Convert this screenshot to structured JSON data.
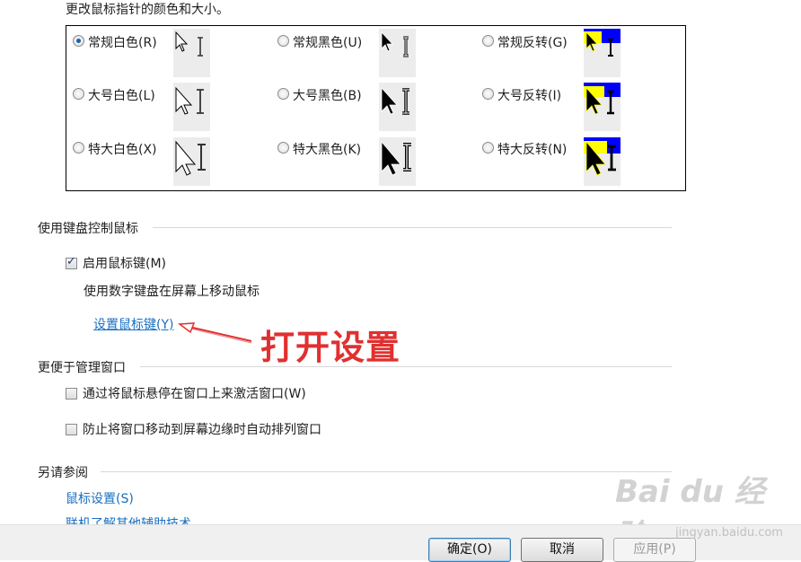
{
  "title": "更改鼠标指针的颜色和大小。",
  "schemes": [
    {
      "label": "常规白色(R)",
      "checked": true,
      "style": "white",
      "size": "normal"
    },
    {
      "label": "常规黑色(U)",
      "checked": false,
      "style": "black",
      "size": "normal"
    },
    {
      "label": "常规反转(G)",
      "checked": false,
      "style": "invert",
      "size": "normal"
    },
    {
      "label": "大号白色(L)",
      "checked": false,
      "style": "white",
      "size": "large"
    },
    {
      "label": "大号黑色(B)",
      "checked": false,
      "style": "black",
      "size": "large"
    },
    {
      "label": "大号反转(I)",
      "checked": false,
      "style": "invert",
      "size": "large"
    },
    {
      "label": "特大白色(X)",
      "checked": false,
      "style": "white",
      "size": "xlarge"
    },
    {
      "label": "特大黑色(K)",
      "checked": false,
      "style": "black",
      "size": "xlarge"
    },
    {
      "label": "特大反转(N)",
      "checked": false,
      "style": "invert",
      "size": "xlarge"
    }
  ],
  "keyboard_section": {
    "heading": "使用键盘控制鼠标",
    "enable_label": "启用鼠标键(M)",
    "enable_checked": true,
    "description": "使用数字键盘在屏幕上移动鼠标",
    "setup_link": "设置鼠标键(Y)"
  },
  "annotation": {
    "text": "打开设置",
    "color": "#e03030"
  },
  "window_section": {
    "heading": "更便于管理窗口",
    "hover_label": "通过将鼠标悬停在窗口上来激活窗口(W)",
    "hover_checked": false,
    "snap_label": "防止将窗口移动到屏幕边缘时自动排列窗口",
    "snap_checked": false
  },
  "see_also": {
    "heading": "另请参阅",
    "links": [
      "鼠标设置(S)",
      "联机了解其他辅助技术"
    ]
  },
  "buttons": {
    "ok": "确定(O)",
    "cancel": "取消",
    "apply": "应用(P)"
  },
  "watermark": {
    "brand": "Bai du 经验",
    "site": "jingyan.baidu.com"
  },
  "colors": {
    "link": "#1a6fc2",
    "invert_yellow": "#ffff00",
    "invert_blue": "#0000ff"
  }
}
